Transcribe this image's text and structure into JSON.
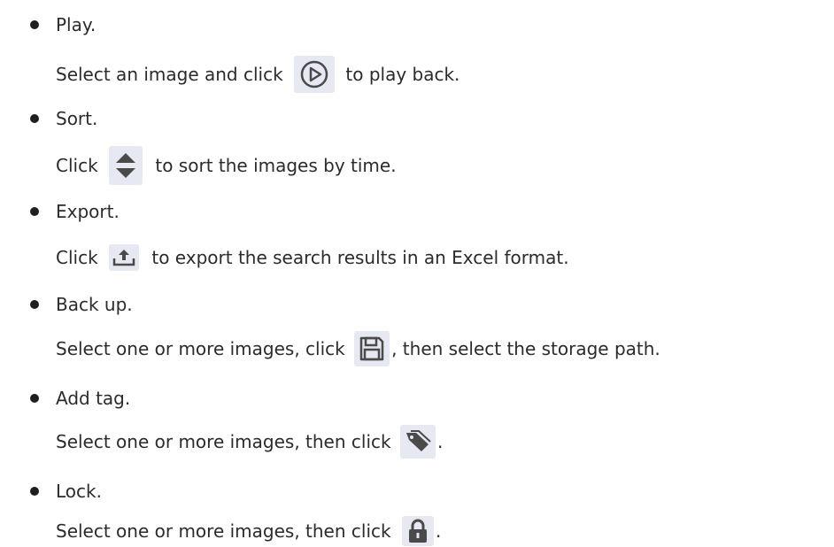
{
  "items": [
    {
      "title": "Play.",
      "desc_before": "Select an image and click ",
      "desc_after": " to play back.",
      "icon": "play-circle-icon"
    },
    {
      "title": "Sort.",
      "desc_before": "Click ",
      "desc_after": " to sort the images by time.",
      "icon": "sort-icon"
    },
    {
      "title": "Export.",
      "desc_before": "Click ",
      "desc_after": " to export the search results in an Excel format.",
      "icon": "export-icon"
    },
    {
      "title": "Back up.",
      "desc_before": "Select one or more images, click ",
      "desc_after": ", then select the storage path.",
      "icon": "save-icon"
    },
    {
      "title": "Add tag.",
      "desc_before": "Select one or more images, then click ",
      "desc_after": ".",
      "icon": "tag-icon"
    },
    {
      "title": "Lock.",
      "desc_before": "Select one or more images, then click ",
      "desc_after": ".",
      "icon": "lock-icon"
    }
  ],
  "colors": {
    "text": "#2b2b2b",
    "icon_bg": "#e6e8f2",
    "icon_fg": "#4a4a4a"
  }
}
